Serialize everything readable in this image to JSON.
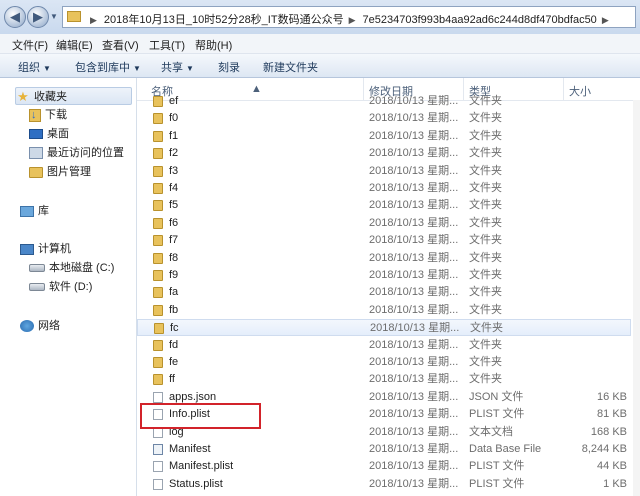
{
  "address": {
    "crumbs": [
      "2018年10月13日_10时52分28秒_IT数码通公众号",
      "7e5234703f993b4aa92ad6c244d8df470bdfac50"
    ]
  },
  "menu": [
    "文件(F)",
    "编辑(E)",
    "查看(V)",
    "工具(T)",
    "帮助(H)"
  ],
  "toolbar": {
    "organize": "组织",
    "include": "包含到库中",
    "share": "共享",
    "burn": "刻录",
    "new_folder": "新建文件夹"
  },
  "nav": {
    "favorites": "收藏夹",
    "downloads": "下载",
    "desktop": "桌面",
    "recent": "最近访问的位置",
    "pictures": "图片管理",
    "libraries": "库",
    "computer": "计算机",
    "local_disk": "本地磁盘 (C:)",
    "software_disk": "软件 (D:)",
    "network": "网络"
  },
  "columns": {
    "name": "名称",
    "date": "修改日期",
    "type": "类型",
    "size": "大小"
  },
  "files": [
    {
      "name": "ef",
      "date": "2018/10/13 星期...",
      "type": "文件夹",
      "size": "",
      "kind": "folder"
    },
    {
      "name": "f0",
      "date": "2018/10/13 星期...",
      "type": "文件夹",
      "size": "",
      "kind": "folder"
    },
    {
      "name": "f1",
      "date": "2018/10/13 星期...",
      "type": "文件夹",
      "size": "",
      "kind": "folder"
    },
    {
      "name": "f2",
      "date": "2018/10/13 星期...",
      "type": "文件夹",
      "size": "",
      "kind": "folder"
    },
    {
      "name": "f3",
      "date": "2018/10/13 星期...",
      "type": "文件夹",
      "size": "",
      "kind": "folder"
    },
    {
      "name": "f4",
      "date": "2018/10/13 星期...",
      "type": "文件夹",
      "size": "",
      "kind": "folder"
    },
    {
      "name": "f5",
      "date": "2018/10/13 星期...",
      "type": "文件夹",
      "size": "",
      "kind": "folder"
    },
    {
      "name": "f6",
      "date": "2018/10/13 星期...",
      "type": "文件夹",
      "size": "",
      "kind": "folder"
    },
    {
      "name": "f7",
      "date": "2018/10/13 星期...",
      "type": "文件夹",
      "size": "",
      "kind": "folder"
    },
    {
      "name": "f8",
      "date": "2018/10/13 星期...",
      "type": "文件夹",
      "size": "",
      "kind": "folder"
    },
    {
      "name": "f9",
      "date": "2018/10/13 星期...",
      "type": "文件夹",
      "size": "",
      "kind": "folder"
    },
    {
      "name": "fa",
      "date": "2018/10/13 星期...",
      "type": "文件夹",
      "size": "",
      "kind": "folder"
    },
    {
      "name": "fb",
      "date": "2018/10/13 星期...",
      "type": "文件夹",
      "size": "",
      "kind": "folder"
    },
    {
      "name": "fc",
      "date": "2018/10/13 星期...",
      "type": "文件夹",
      "size": "",
      "kind": "folder"
    },
    {
      "name": "fd",
      "date": "2018/10/13 星期...",
      "type": "文件夹",
      "size": "",
      "kind": "folder"
    },
    {
      "name": "fe",
      "date": "2018/10/13 星期...",
      "type": "文件夹",
      "size": "",
      "kind": "folder"
    },
    {
      "name": "ff",
      "date": "2018/10/13 星期...",
      "type": "文件夹",
      "size": "",
      "kind": "folder"
    },
    {
      "name": "apps.json",
      "date": "2018/10/13 星期...",
      "type": "JSON 文件",
      "size": "16 KB",
      "kind": "file"
    },
    {
      "name": "Info.plist",
      "date": "2018/10/13 星期...",
      "type": "PLIST 文件",
      "size": "81 KB",
      "kind": "file"
    },
    {
      "name": "log",
      "date": "2018/10/13 星期...",
      "type": "文本文档",
      "size": "168 KB",
      "kind": "file"
    },
    {
      "name": "Manifest",
      "date": "2018/10/13 星期...",
      "type": "Data Base File",
      "size": "8,244 KB",
      "kind": "db"
    },
    {
      "name": "Manifest.plist",
      "date": "2018/10/13 星期...",
      "type": "PLIST 文件",
      "size": "44 KB",
      "kind": "file"
    },
    {
      "name": "Status.plist",
      "date": "2018/10/13 星期...",
      "type": "PLIST 文件",
      "size": "1 KB",
      "kind": "file"
    }
  ]
}
